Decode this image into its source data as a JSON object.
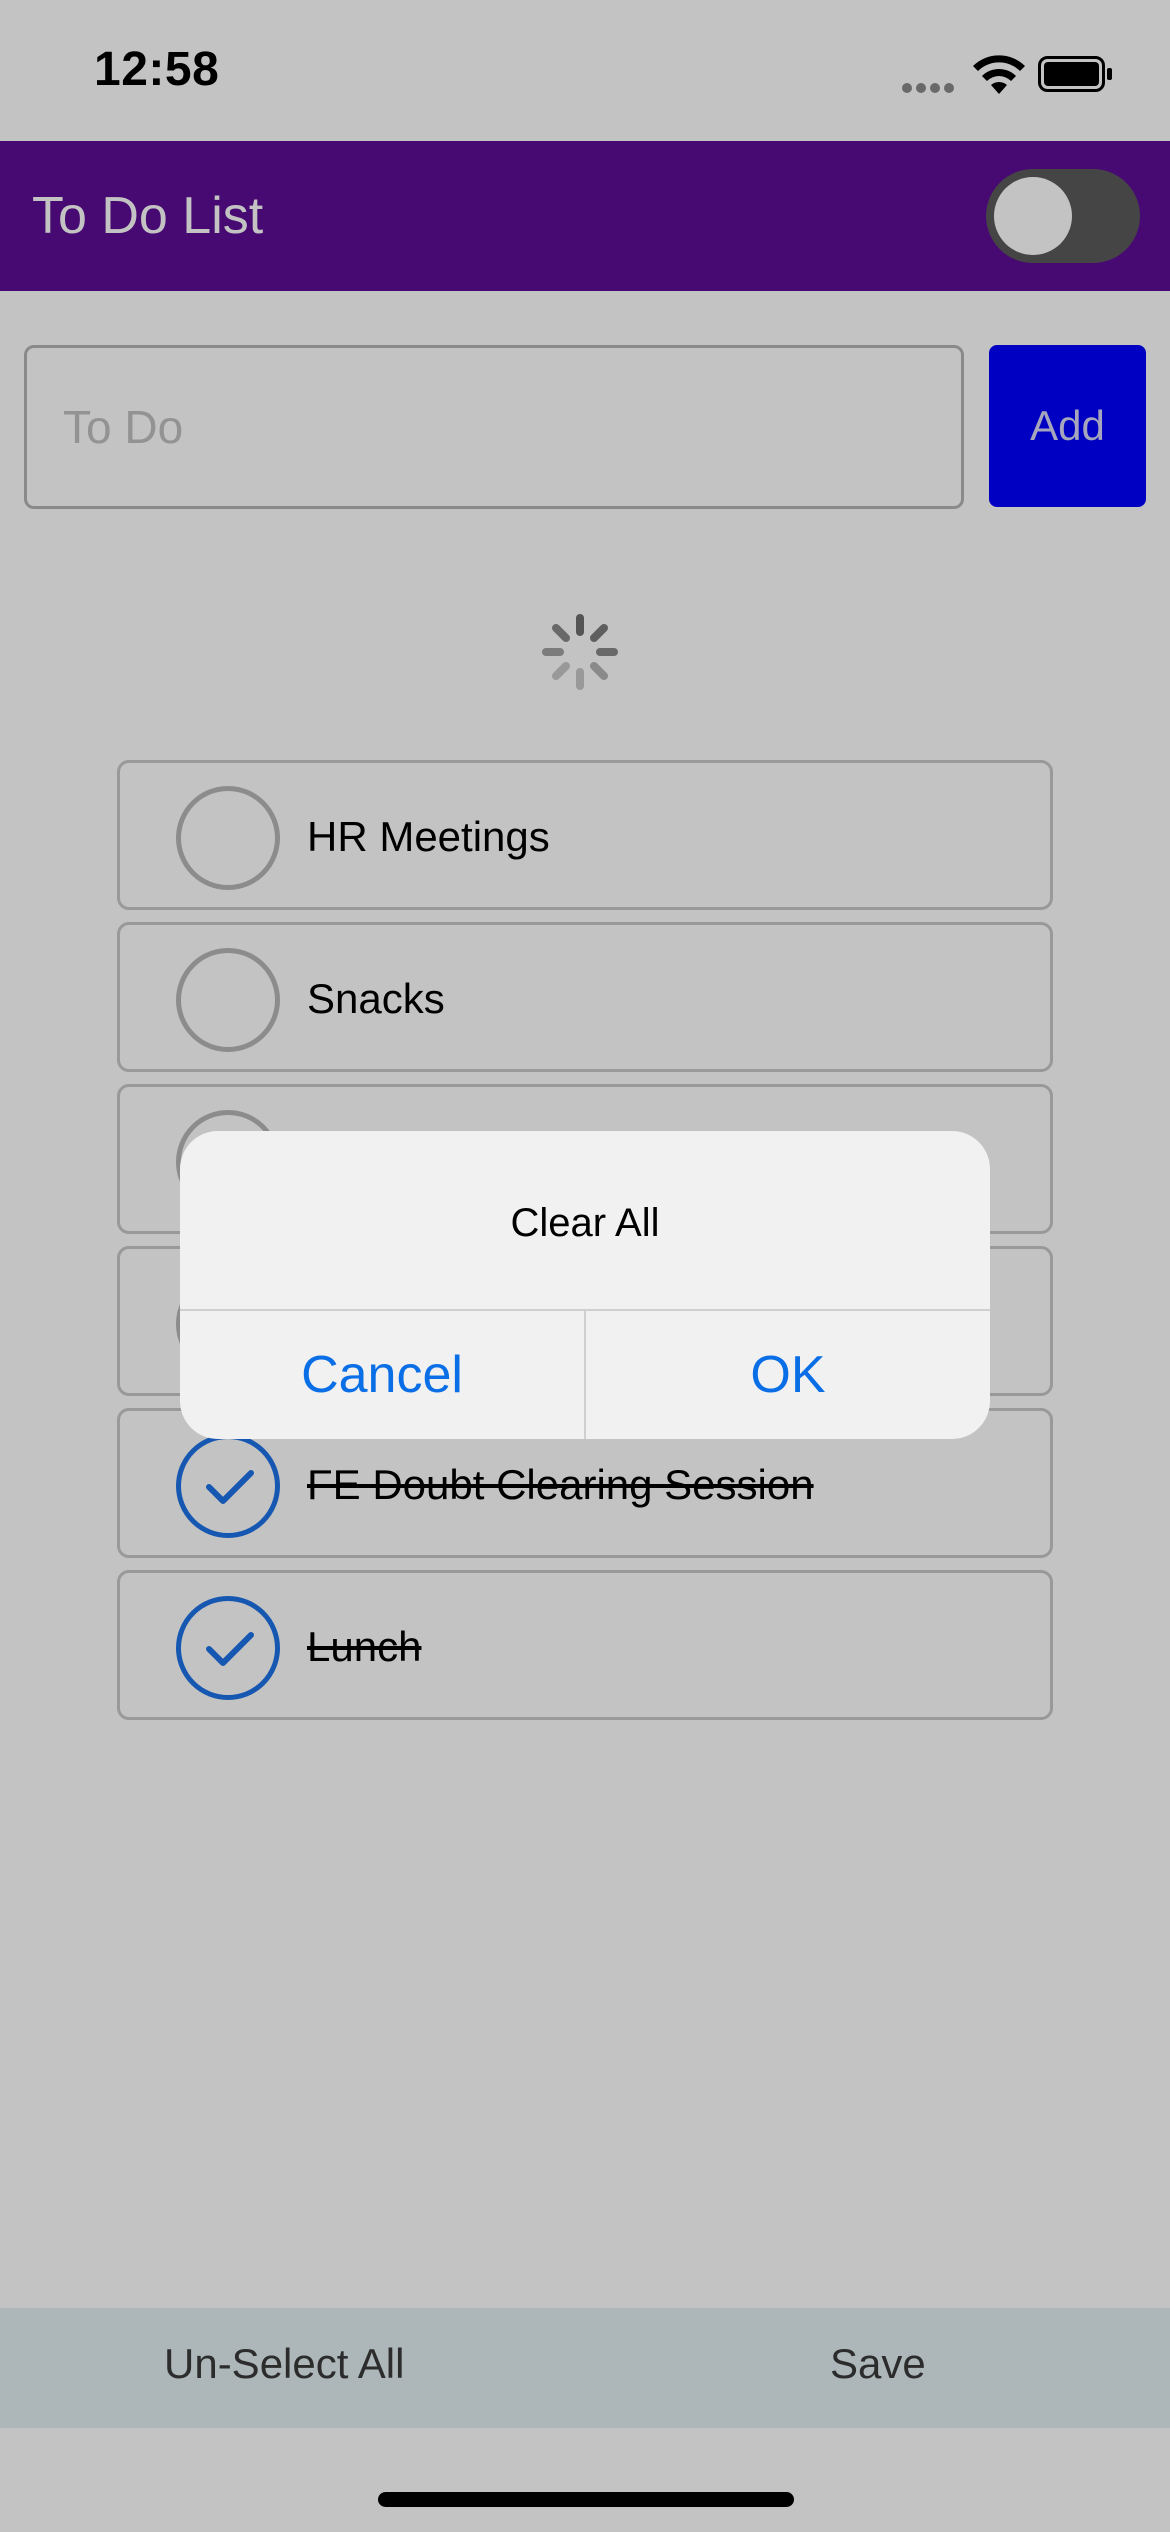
{
  "status_bar": {
    "time": "12:58"
  },
  "app_bar": {
    "title": "To Do List",
    "toggle_on": false
  },
  "input": {
    "placeholder": "To Do",
    "value": "",
    "add_label": "Add"
  },
  "todos": [
    {
      "label": "HR Meetings",
      "done": false
    },
    {
      "label": "Snacks",
      "done": false
    },
    {
      "label": "",
      "done": false
    },
    {
      "label": "",
      "done": false
    },
    {
      "label": "FE Doubt Clearing Session",
      "done": true
    },
    {
      "label": "Lunch",
      "done": true
    }
  ],
  "bottom_bar": {
    "unselect_label": "Un-Select All",
    "save_label": "Save"
  },
  "dialog": {
    "title": "Clear All",
    "cancel_label": "Cancel",
    "ok_label": "OK"
  },
  "colors": {
    "app_bar": "#5e0c96",
    "add_button": "#0000ff",
    "check_accent": "#1e73e8",
    "dialog_button": "#0a6fe6"
  }
}
